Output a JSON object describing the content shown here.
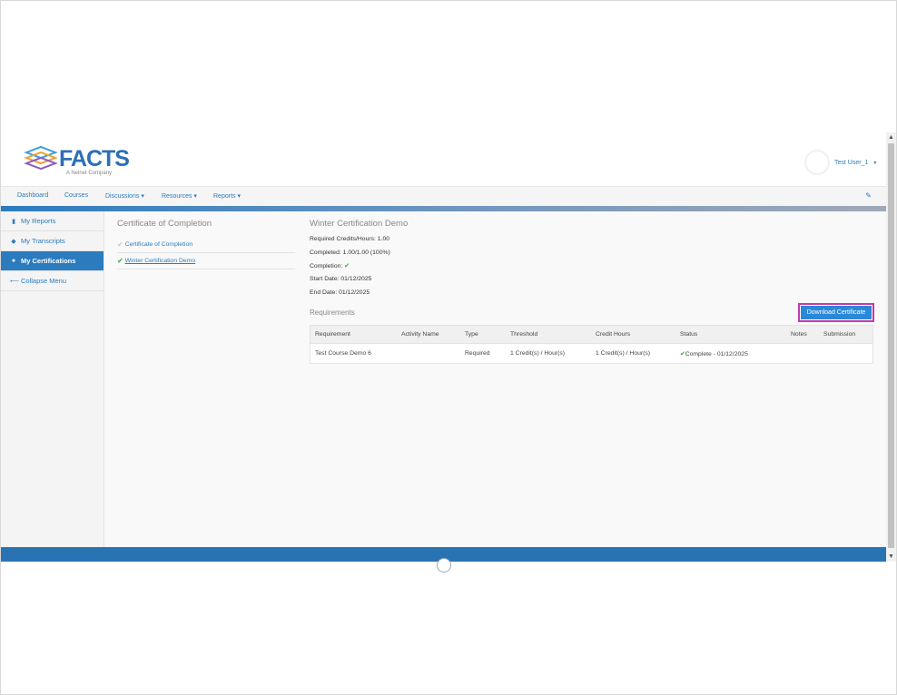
{
  "header": {
    "logo_text": "FACTS",
    "logo_subtitle": "A Nelnet Company",
    "user_name": "Test User_1"
  },
  "nav": {
    "items": [
      "Dashboard",
      "Courses",
      "Discussions",
      "Resources",
      "Reports"
    ]
  },
  "sidebar": {
    "items": [
      {
        "label": "My Reports",
        "icon": "file-icon"
      },
      {
        "label": "My Transcripts",
        "icon": "tag-icon"
      },
      {
        "label": "My Certifications",
        "icon": "circle-icon"
      },
      {
        "label": "Collapse Menu",
        "icon": "arrow-left-icon"
      }
    ]
  },
  "certificates": {
    "title": "Certificate of Completion",
    "items": [
      {
        "label": "Certificate of Completion"
      },
      {
        "label": "Winter Certification Demo"
      }
    ]
  },
  "detail": {
    "title": "Winter Certification Demo",
    "required": "Required Credits/Hours: 1.00",
    "completed": "Completed: 1.00/1.00 (100%)",
    "completion": "Completion:",
    "start": "Start Date: 01/12/2025",
    "end": "End Date: 01/12/2025"
  },
  "requirements": {
    "title": "Requirements",
    "download_label": "Download Certificate",
    "columns": [
      "Requirement",
      "Activity Name",
      "Type",
      "Threshold",
      "Credit Hours",
      "Status",
      "Notes",
      "Submission"
    ],
    "rows": [
      {
        "requirement": "Test Course Demo 6",
        "activity": "",
        "type": "Required",
        "threshold": "1 Credit(s) / Hour(s)",
        "credit_hours": "1 Credit(s) / Hour(s)",
        "status": "Complete - 01/12/2025",
        "notes": "",
        "submission": ""
      }
    ]
  },
  "colors": {
    "brand_blue": "#2b7bbf",
    "success_green": "#5cb85c",
    "highlight_magenta": "#c23bae"
  }
}
